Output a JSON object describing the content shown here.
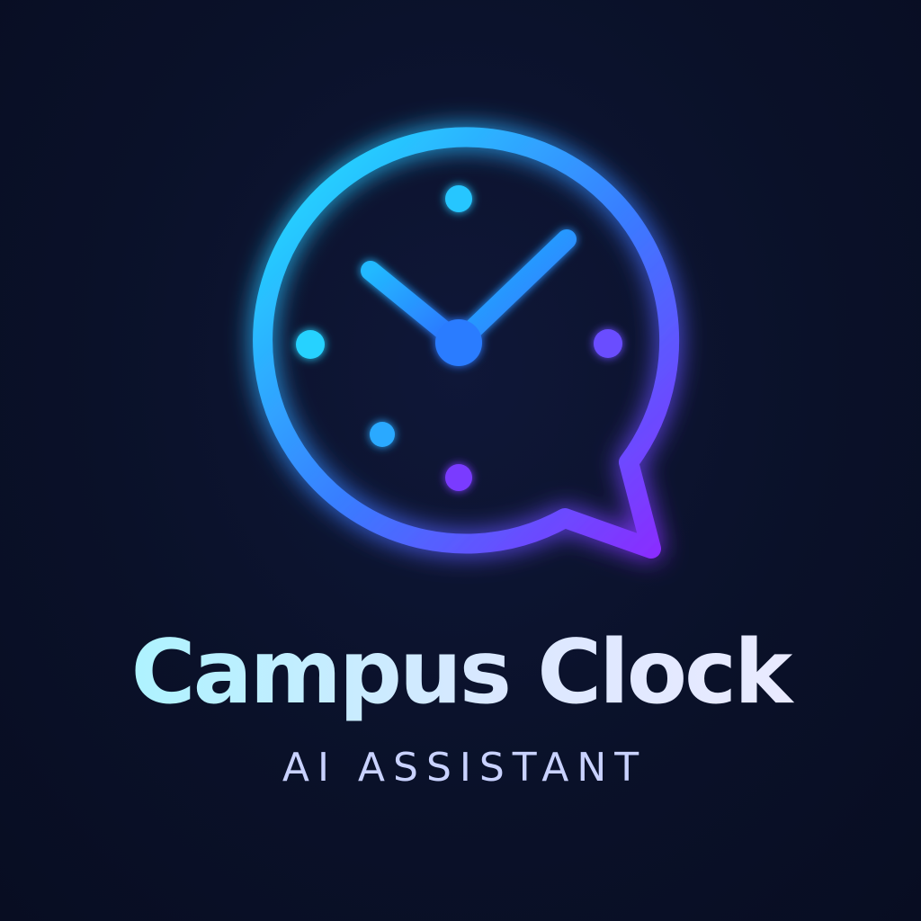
{
  "brand": {
    "title": "Campus Clock",
    "subtitle": "AI ASSISTANT"
  },
  "logo": {
    "icon": "clock-chat-bubble-icon",
    "clock_time_shown": "10:08",
    "colors": {
      "gradient_start": "#1fe6ff",
      "gradient_mid": "#3a7bff",
      "gradient_end": "#8b2bff",
      "background": "#0a1129",
      "title_start": "#9ef7ff",
      "title_end": "#f0ecff",
      "subtitle": "#c9d2ff"
    }
  }
}
